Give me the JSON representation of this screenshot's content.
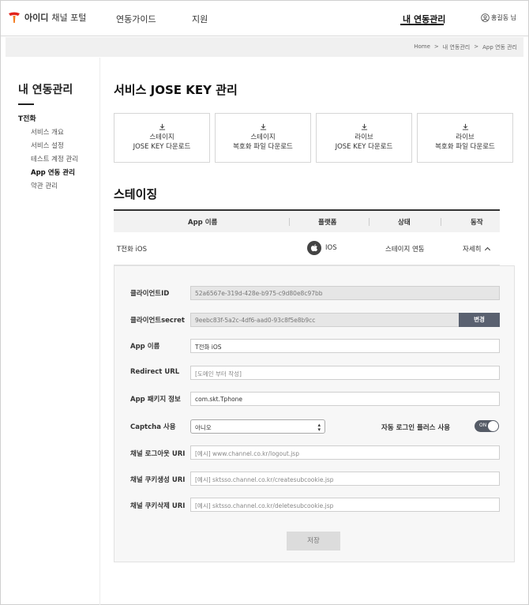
{
  "header": {
    "brand": "아이디",
    "brand_sub": "채널 포털",
    "nav": {
      "guide": "연동가이드",
      "support": "지원",
      "mine": "내 연동관리"
    },
    "user": "홍길동 님"
  },
  "breadcrumb": [
    "Home",
    ">",
    "내 연동관리",
    ">",
    "App 연동 관리"
  ],
  "sidebar": {
    "title": "내 연동관리",
    "group": "T전화",
    "items": [
      {
        "label": "서비스 개요"
      },
      {
        "label": "서비스 설정"
      },
      {
        "label": "테스트 계정 관리"
      },
      {
        "label": "App 연동 관리"
      },
      {
        "label": "약관 관리"
      }
    ]
  },
  "main": {
    "title": "서비스 JOSE KEY 관리",
    "downloads": [
      {
        "line1": "스테이지",
        "line2": "JOSE KEY 다운로드"
      },
      {
        "line1": "스테이지",
        "line2": "복호화 파일 다운로드"
      },
      {
        "line1": "라이브",
        "line2": "JOSE KEY 다운로드"
      },
      {
        "line1": "라이브",
        "line2": "복호화 파일 다운로드"
      }
    ],
    "section_title": "스테이징",
    "table": {
      "headers": [
        "App 이름",
        "플랫폼",
        "상태",
        "동작"
      ],
      "row": {
        "app_name": "T전화 iOS",
        "platform": "IOS",
        "status": "스테이지 연동",
        "action": "자세히"
      }
    },
    "form": {
      "client_id": {
        "label": "클라이언트ID",
        "value": "52a6567e-319d-428e-b975-c9d80e8c97bb"
      },
      "client_secret": {
        "label": "클라이언트secret",
        "value": "9eebc83f-5a2c-4df6-aad0-93c8f5e8b9cc",
        "change_label": "변경"
      },
      "app_name": {
        "label": "App 이름",
        "value": "T전화 iOS"
      },
      "redirect_url": {
        "label": "Redirect URL",
        "placeholder": "[도메인 부터 작성]"
      },
      "app_package": {
        "label": "App 패키지 정보",
        "value": "com.skt.Tphone"
      },
      "captcha": {
        "label": "Captcha 사용",
        "value": "아니오"
      },
      "auto_login": {
        "label": "자동 로그인 플러스 사용",
        "state": "ON"
      },
      "logout_uri": {
        "label": "채널 로그아웃 URI",
        "placeholder": "[예시] www.channel.co.kr/logout.jsp"
      },
      "cookie_create_uri": {
        "label": "채널 쿠키생성 URI",
        "placeholder": "[예시] sktsso.channel.co.kr/createsubcookie.jsp"
      },
      "cookie_delete_uri": {
        "label": "채널 쿠키삭제 URI",
        "placeholder": "[예시] sktsso.channel.co.kr/deletesubcookie.jsp"
      },
      "save_label": "저장"
    }
  },
  "colors": {
    "brand_red": "#e2231a",
    "toggle_on": "#555b66",
    "header_rule": "#333333"
  }
}
